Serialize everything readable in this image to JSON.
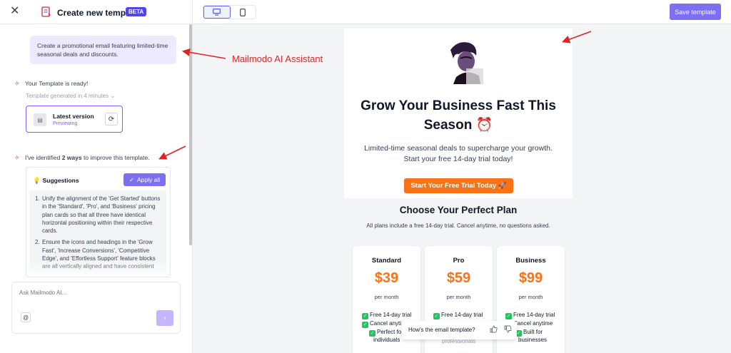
{
  "header": {
    "close_icon": "close-icon",
    "title": "Create new template",
    "beta_badge": "BETA",
    "save_label": "Save template",
    "desktop_icon": "desktop-icon",
    "mobile_icon": "mobile-icon",
    "accent_color": "#7c6ff2"
  },
  "sidebar": {
    "user_message": "Create a promotional email featuring limited-time seasonal deals and discounts.",
    "ready_text": "Your Template is ready!",
    "generated_text": "Template generated in 4 minutes",
    "version_title": "Latest version",
    "version_sub": "Previewing",
    "improve_pre": "I've identified ",
    "improve_bold": "2 ways",
    "improve_post": " to improve this template.",
    "suggestions_title": "Suggestions",
    "apply_all": "Apply all",
    "suggestions": [
      "Unify the alignment of the 'Get Started' buttons in the 'Standard', 'Pro', and 'Business' pricing plan cards so that all three have identical horizontal positioning within their respective cards.",
      "Ensure the icons and headings in the 'Grow Fast', 'Increase Conversions', 'Competitive Edge', and 'Effortless Support' feature blocks are all vertically aligned and have consistent"
    ],
    "ask_placeholder": "Ask Mailmodo AI...",
    "at_label": "@",
    "send_label": "›"
  },
  "annotation": {
    "label": "Mailmodo AI Assistant",
    "color": "#dc2626"
  },
  "email": {
    "hero_title_line1": "Grow Your Business Fast This",
    "hero_title_line2": "Season ⏰",
    "hero_sub_line1": "Limited-time seasonal deals to supercharge your growth.",
    "hero_sub_line2": "Start your free 14-day trial today!",
    "cta_label": "Start Your Free Trial Today 🚀",
    "plans_title": "Choose Your Perfect Plan",
    "plans_sub": "All plans include a free 14-day trial. Cancel anytime, no questions asked.",
    "brand_color": "#f97316",
    "plans": [
      {
        "name": "Standard",
        "price": "$39",
        "per": "per month",
        "f1": "Free 14-day trial",
        "f2": "Cancel anyti",
        "f3": "Perfect fo",
        "f3b": "individuals"
      },
      {
        "name": "Pro",
        "price": "$59",
        "per": "per month",
        "f1": "Free 14-day trial",
        "f2": "",
        "f3": "",
        "f3b": "professionals"
      },
      {
        "name": "Business",
        "price": "$99",
        "per": "per month",
        "f1": "Free 14-day trial",
        "f2": "Cancel anytime",
        "f3": "Built for",
        "f3b": "businesses"
      }
    ]
  },
  "feedback": {
    "question": "How's the email template?",
    "thumbs_up": "👍",
    "thumbs_down": "👎"
  }
}
